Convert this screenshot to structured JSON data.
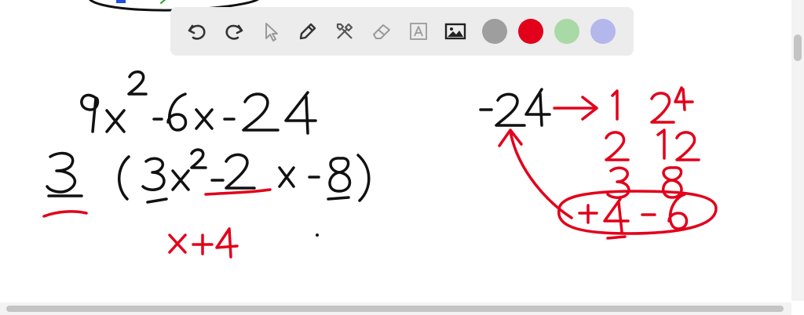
{
  "toolbar": {
    "tools": [
      {
        "name": "undo-icon"
      },
      {
        "name": "redo-icon"
      },
      {
        "name": "select-cursor-icon"
      },
      {
        "name": "pencil-icon"
      },
      {
        "name": "tools-icon"
      },
      {
        "name": "eraser-icon"
      },
      {
        "name": "text-icon"
      },
      {
        "name": "image-icon"
      }
    ],
    "colors": [
      "#9e9e9e",
      "#e2001a",
      "#a9d9a6",
      "#b3b7ec"
    ]
  },
  "ink_colors": {
    "black": "#111111",
    "red": "#e2001a"
  }
}
